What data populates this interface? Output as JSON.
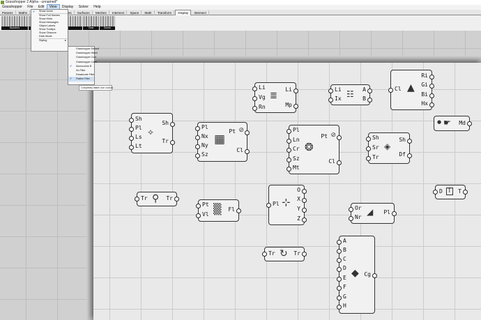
{
  "window": {
    "title": "Grasshopper 2 Alpha - unnamed*"
  },
  "menubar": [
    "Grasshopper",
    "File",
    "Edit",
    "View",
    "Display",
    "Solver",
    "Help"
  ],
  "tabs": [
    "Params",
    "Maths",
    "Data",
    "Vectors",
    "Curves",
    "Surfaces",
    "Meshes",
    "Intersect",
    "Space",
    "Math",
    "Transform",
    "Display",
    "Intersect"
  ],
  "active_tab": "Display",
  "ribbon_groups": [
    "Numbers",
    "",
    "",
    "",
    "",
    "Time",
    "Scene"
  ],
  "view_menu": {
    "items": [
      {
        "label": "Show Icons",
        "checked": true
      },
      {
        "label": "Show Full Names",
        "checked": false
      },
      {
        "label": "Show Hints",
        "checked": false
      },
      {
        "label": "Show Messages",
        "checked": false
      },
      {
        "label": "Object Labels",
        "checked": false
      },
      {
        "label": "Show Tooltips",
        "checked": false
      },
      {
        "label": "Show Obscure",
        "checked": false
      },
      {
        "label": "Dark Mode",
        "checked": false
      },
      {
        "label": "Styling",
        "checked": false,
        "submenu": true
      }
    ]
  },
  "styling_submenu": {
    "items": [
      {
        "label": "Grasshopper Default",
        "checked": false
      },
      {
        "label": "Grasshopper Warm",
        "checked": false
      },
      {
        "label": "Grasshopper Cool",
        "checked": false
      },
      {
        "label": "Grasshopper Calm",
        "checked": false
      },
      {
        "label": "Monocrome B",
        "checked": true
      },
      {
        "label": "No Filter",
        "checked": false
      },
      {
        "label": "Desaturate Filter",
        "checked": false
      },
      {
        "label": "Flatten Filter",
        "checked": true,
        "highlighted": true
      }
    ],
    "tooltip": "Completely flatten icon colours"
  },
  "components": [
    {
      "id": "c1",
      "inputs": [
        "Sh",
        "Pl",
        "Ls",
        "Lt"
      ],
      "outputs": [
        "Sh",
        "Tr"
      ],
      "icon": "fingerprint-icon"
    },
    {
      "id": "c2",
      "inputs": [
        "Pl",
        "Nx",
        "Ny",
        "Sz"
      ],
      "outputs": [
        "Pt",
        "Cl"
      ],
      "icon": "grid-icon"
    },
    {
      "id": "c3",
      "inputs": [
        "Li",
        "Vg",
        "Rn"
      ],
      "outputs": [
        "Li",
        "Mp"
      ],
      "icon": "bars-icon"
    },
    {
      "id": "c4",
      "inputs": [
        "Pl",
        "Ln",
        "Cr",
        "Sz",
        "Mt"
      ],
      "outputs": [
        "Pt",
        "Cl"
      ],
      "icon": "radial-icon"
    },
    {
      "id": "c5",
      "inputs": [
        "Li",
        "Ix"
      ],
      "outputs": [
        "A",
        "B"
      ],
      "icon": "split-list-icon"
    },
    {
      "id": "c6",
      "inputs": [
        "Cl"
      ],
      "outputs": [
        "Ri",
        "Gi",
        "Bi",
        "Hx"
      ],
      "icon": "pyramid-icon"
    },
    {
      "id": "c7",
      "inputs": [
        "Sh",
        "Sr",
        "Tr"
      ],
      "outputs": [
        "Sh",
        "Df"
      ],
      "icon": "shader-icon"
    },
    {
      "id": "c8",
      "inputs": [],
      "outputs": [
        "Md"
      ],
      "icon": "hand-icon"
    },
    {
      "id": "c9",
      "inputs": [
        "Tr"
      ],
      "outputs": [
        "Tr"
      ],
      "icon": "magnifier-icon"
    },
    {
      "id": "c10",
      "inputs": [
        "Pt",
        "Vl"
      ],
      "outputs": [
        "Fl"
      ],
      "icon": "field-icon"
    },
    {
      "id": "c11",
      "inputs": [
        "Pl"
      ],
      "outputs": [
        "O",
        "X",
        "Y",
        "Z"
      ],
      "icon": "axes-icon"
    },
    {
      "id": "c12",
      "inputs": [
        "Or",
        "Nr"
      ],
      "outputs": [
        "Pl"
      ],
      "icon": "plane-icon"
    },
    {
      "id": "c13",
      "inputs": [
        "D"
      ],
      "outputs": [
        "T"
      ],
      "icon": "text-tag-icon"
    },
    {
      "id": "c14",
      "inputs": [
        "Tr"
      ],
      "outputs": [
        "Tr"
      ],
      "icon": "rotate-icon"
    },
    {
      "id": "c15",
      "inputs": [
        "A",
        "B",
        "C",
        "D",
        "E",
        "F",
        "G",
        "H"
      ],
      "outputs": [
        "Cg"
      ],
      "icon": "gem-icon"
    }
  ],
  "icon_glyphs": {
    "fingerprint-icon": "⟡",
    "grid-icon": "▦",
    "bars-icon": "≣",
    "radial-icon": "❂",
    "split-list-icon": "☷",
    "pyramid-icon": "▲",
    "shader-icon": "◈",
    "hand-icon": "☛",
    "magnifier-icon": "⚲",
    "field-icon": "▒",
    "axes-icon": "⊹",
    "plane-icon": "◢",
    "text-tag-icon": "T",
    "rotate-icon": "↻",
    "gem-icon": "◆",
    "eye-off-icon": "⊘"
  }
}
